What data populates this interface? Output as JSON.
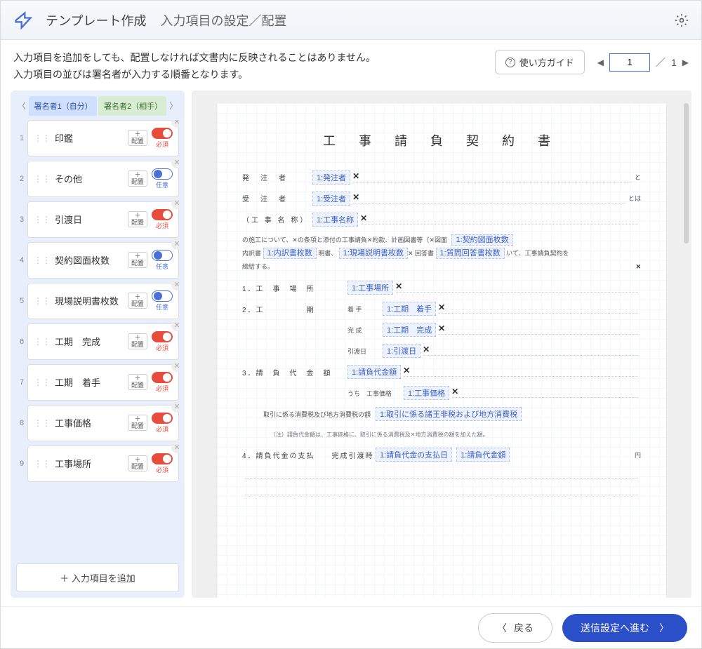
{
  "header": {
    "title": "テンプレート作成",
    "subtitle": "入力項目の設定／配置"
  },
  "instructions": {
    "line1": "入力項目を追加をしても、配置しなければ文書内に反映されることはありません。",
    "line2": "入力項目の並びは署名者が入力する順番となります。"
  },
  "guide_button": "使い方ガイド",
  "pager": {
    "current": "1",
    "total": "1",
    "sep": "／"
  },
  "tabs": {
    "signer1": "署名者1（自分）",
    "signer2": "署名者2（相手）"
  },
  "place_btn": {
    "plus": "＋",
    "label": "配置"
  },
  "req_label": "必須",
  "opt_label": "任意",
  "fields": [
    {
      "num": "1",
      "label": "印鑑",
      "required": true
    },
    {
      "num": "2",
      "label": "その他",
      "required": false
    },
    {
      "num": "3",
      "label": "引渡日",
      "required": true
    },
    {
      "num": "4",
      "label": "契約図面枚数",
      "required": false
    },
    {
      "num": "5",
      "label": "現場説明書枚数",
      "required": false
    },
    {
      "num": "6",
      "label": "工期　完成",
      "required": true
    },
    {
      "num": "7",
      "label": "工期　着手",
      "required": true
    },
    {
      "num": "8",
      "label": "工事価格",
      "required": true
    },
    {
      "num": "9",
      "label": "工事場所",
      "required": true
    }
  ],
  "add_field": "＋ 入力項目を追加",
  "doc": {
    "title": "工 事 請 負 契 約 書",
    "orderer_lbl": "発　注　者",
    "contractor_lbl": "受　注　者",
    "name_lbl": "（工 事 名 称）",
    "body1": "の施工について、",
    "body1b": "の条項と添付の工事請負",
    "body1c": "約款、計画図書等（",
    "body1d": "図面",
    "body2": "内訳書",
    "body2b": "明書、",
    "body2c": "回答書",
    "body2d": "いて、工事請負契約を",
    "body3": "締結する。",
    "s1_lbl": "1．工　事　場　所",
    "s2_lbl": "2．工　　　　　期",
    "s2_start": "着 手",
    "s2_end": "完 成",
    "s2_deliver": "引渡日",
    "s3_lbl": "3．請　負　代　金　額",
    "s3_sub": "うち　工事価格",
    "s3_tax_lbl": "取引に係る消費税及び地方消費税の額",
    "s3_note": "（注）請負代金額は、工事価格に、取引に係る消費税及",
    "s3_note2": "地方消費税の額を加えた額。",
    "s4_lbl": "4．請負代金の支払　　完成引渡時",
    "s4_yen": "円",
    "to": "と",
    "toha": "とは",
    "placed": {
      "orderer": "1:発注者",
      "contractor": "1:受注者",
      "name": "1:工事名称",
      "drawings": "1:契約図面枚数",
      "breakdown": "1:内訳書枚数",
      "desc": "1:現場説明書枚数",
      "qa": "1:質問回答書枚数",
      "location": "1:工事場所",
      "start": "1:工期　着手",
      "end": "1:工期　完成",
      "deliver": "1:引渡日",
      "amount": "1:請負代金額",
      "price": "1:工事価格",
      "tax": "1:取引に係る諸王非税および地方消費税",
      "paydate": "1:請負代金の支払日",
      "payamount": "1:請負代金額"
    }
  },
  "footer": {
    "back": "戻る",
    "next": "送信設定へ進む"
  }
}
